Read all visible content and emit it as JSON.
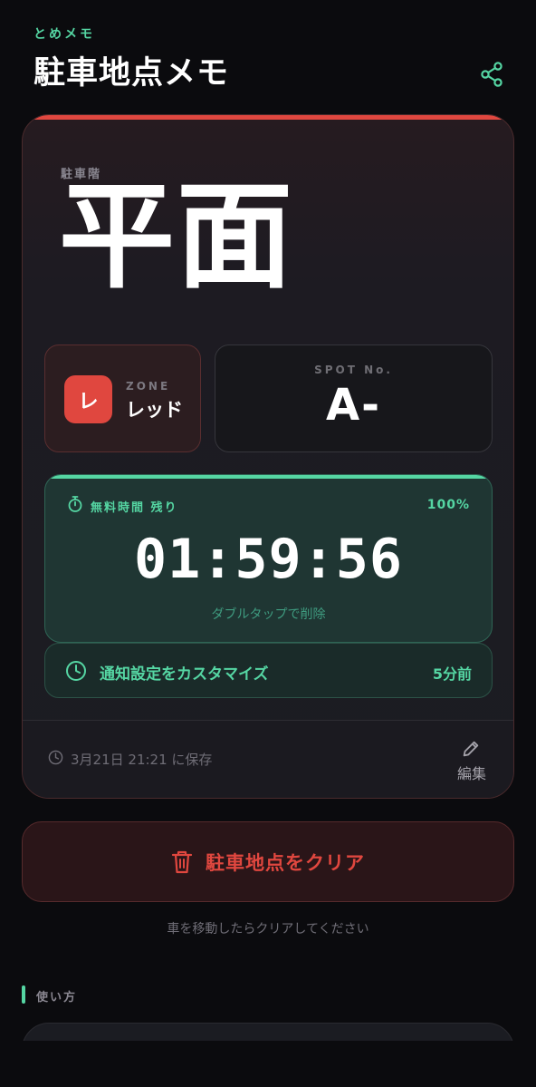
{
  "header": {
    "app_subtitle": "とめメモ",
    "title": "駐車地点メモ",
    "share_icon": "share-icon"
  },
  "parking": {
    "floor_label": "駐車階",
    "floor_value": "平面",
    "zone": {
      "label": "ZONE",
      "chip_letter": "レ",
      "name": "レッド",
      "color": "#e0473f"
    },
    "spot": {
      "label": "SPOT No.",
      "value": "A-"
    }
  },
  "timer": {
    "label": "無料時間 残り",
    "percent_text": "100%",
    "progress_fraction": 1.0,
    "value": "01:59:56",
    "hint": "ダブルタップで削除",
    "accent_color": "#55d6a3"
  },
  "notification": {
    "label": "通知設定をカスタマイズ",
    "value": "5分前"
  },
  "footer": {
    "saved_text": "3月21日 21:21 に保存",
    "edit_label": "編集"
  },
  "actions": {
    "clear_label": "駐車地点をクリア",
    "clear_hint": "車を移動したらクリアしてください"
  },
  "howto": {
    "label": "使い方"
  }
}
